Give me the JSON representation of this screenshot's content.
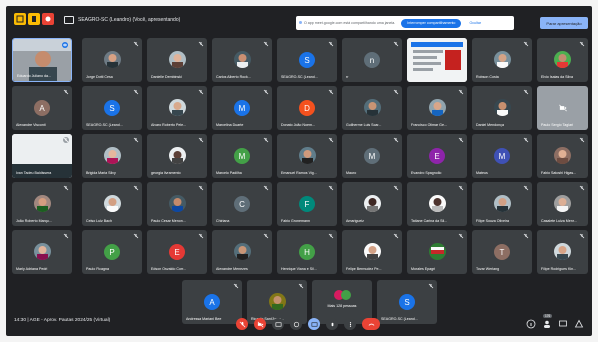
{
  "topbar": {
    "meeting_title": "SEAGRO-SC (Leandro) (Você, apresentando)",
    "share_banner_text": "O app meet.google.com está compartilhando uma janela.",
    "stop_sharing_label": "Interromper compartilhamento",
    "hide_label": "Ocultar",
    "stop_presenting_label": "Parar apresentação"
  },
  "participants": {
    "row1": [
      "Eduardo Juliano da...",
      "Jorge Dotti Cesa",
      "Danielle Dembinski",
      "Carlos Alberto Rock...",
      "SEAGRO-SC (Leand...",
      "rr",
      "",
      "Robson Costa",
      "Elvio Isaias da Silva"
    ],
    "row2": [
      "Alexandre Visconti",
      "SEAGRO-SC (Leand...",
      "Alvaro Roberto Pele...",
      "Marcelina Duarte",
      "Donato João Noem...",
      "Guilherme Luis Scar...",
      "Francisco Olimar Ge...",
      "Daniel Mendonça",
      "Paulo Sergio Taglari"
    ],
    "row3": [
      "Ivan Tadeu Baldissera",
      "Brigida Maria Silvy",
      "georgia livramento",
      "Marcelo Padilha",
      "Emanuel Ramos Vig...",
      "Mauro",
      "Evandro Spagnollo",
      "Mateus",
      "Fabio Satoshi Higas..."
    ],
    "row4": [
      "João Roberto Marqu...",
      "Celso Luiz Bach",
      "Paulo Cesar Menon...",
      "Chiriana",
      "Fabio Gronemann",
      "Amarigueiz",
      "Tatiane Carina da Sil...",
      "Filipe Souza Oliveira",
      "Casalete Luiza Menr..."
    ],
    "row5": [
      "Marly Adriana Pedri",
      "Paulo Ficagna",
      "Edson Osvaldo Corr...",
      "Alexandre Menezes",
      "Henrique Viana e Sil...",
      "Felipe Bermudez Pe...",
      "Morales Epagri",
      "Tovar Werlang",
      "Filipe Rodrigues Kin..."
    ],
    "row6": [
      "Andressa Mariani Bee",
      "Ricardo Sant'Anna...",
      "Mais 128 pessoas",
      "SEAGRO-SC (Leand..."
    ]
  },
  "avatar_letters": {
    "r1c5": "S",
    "r1c6": "n",
    "r2c1": "A",
    "r2c2": "S",
    "r2c4": "M",
    "r2c5": "D",
    "r3c4": "M",
    "r3c6": "M",
    "r3c7": "E",
    "r3c8": "M",
    "r4c4": "C",
    "r4c5": "F",
    "r5c2": "P",
    "r5c3": "E",
    "r5c5": "H",
    "r5c8": "T",
    "r6c1": "A",
    "r6c4": "S"
  },
  "colors": {
    "teal": "#00897b",
    "blue": "#1a73e8",
    "green": "#43a047",
    "orange": "#f4511e",
    "purple": "#8e24aa",
    "red": "#e53935",
    "brown": "#8d6e63",
    "slate": "#5f6e78",
    "bluegray": "#3f51b5",
    "pink": "#d81b60"
  },
  "bottombar": {
    "meeting_info": "14:30 | AGE - Aprov. Pautas 2024/25 (Virtual)",
    "participant_count": "176"
  }
}
